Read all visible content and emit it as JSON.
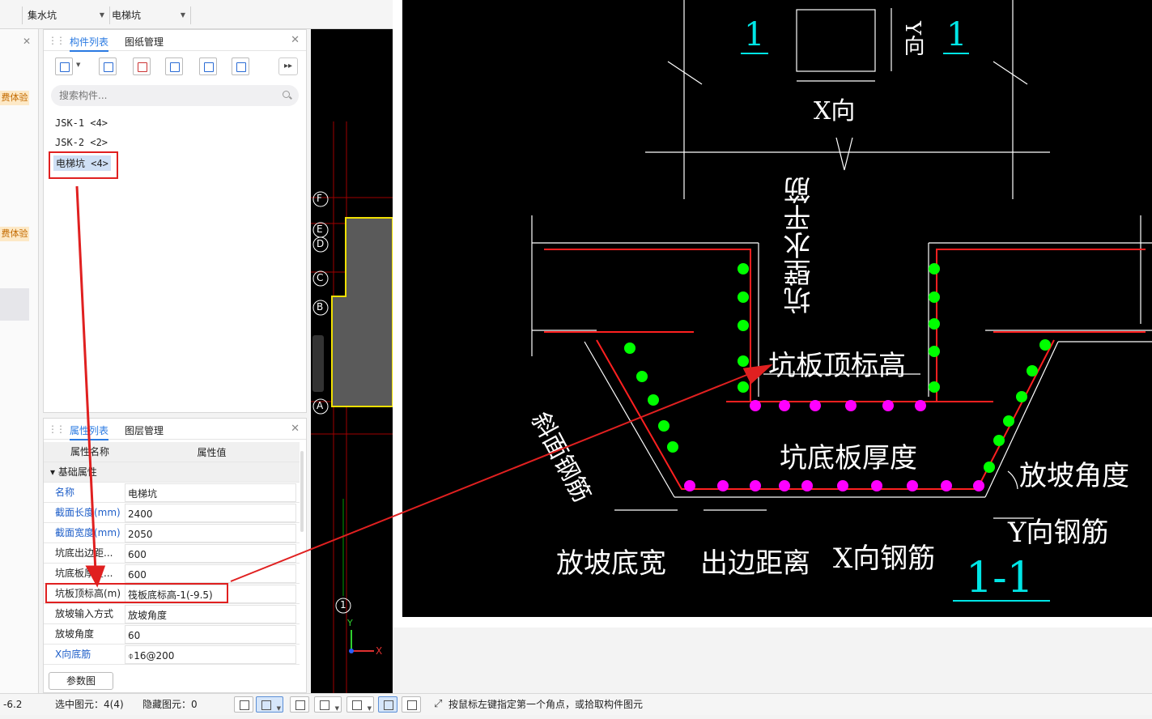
{
  "toolbar": {
    "left_value": "",
    "type_select": "集水坑",
    "component_select": "电梯坑"
  },
  "left_strip": {
    "badge_1": "费体验",
    "badge_2": "费体验"
  },
  "component_panel": {
    "tabs": [
      {
        "label": "构件列表",
        "active": true
      },
      {
        "label": "图纸管理",
        "active": false
      }
    ],
    "more_label": "▸▸",
    "search_placeholder": "搜索构件...",
    "items": [
      {
        "label": "JSK-1 <4>"
      },
      {
        "label": "JSK-2 <2>"
      },
      {
        "label": "电梯坑 <4>",
        "selected": true
      }
    ]
  },
  "properties_panel": {
    "tabs": [
      {
        "label": "属性列表",
        "active": true
      },
      {
        "label": "图层管理",
        "active": false
      }
    ],
    "header": {
      "name": "属性名称",
      "value": "属性值"
    },
    "group": "基础属性",
    "rows": [
      {
        "name": "名称",
        "value": "电梯坑",
        "blue": true
      },
      {
        "name": "截面长度(mm)",
        "value": "2400",
        "blue": true
      },
      {
        "name": "截面宽度(mm)",
        "value": "2050",
        "blue": true
      },
      {
        "name": "坑底出边距...",
        "value": "600",
        "blue": false
      },
      {
        "name": "坑底板厚度...",
        "value": "600",
        "blue": false
      },
      {
        "name": "坑板顶标高(m)",
        "value": "筏板底标高-1(-9.5)",
        "blue": false
      },
      {
        "name": "放坡输入方式",
        "value": "放坡角度",
        "blue": false
      },
      {
        "name": "放坡角度",
        "value": "60",
        "blue": false
      },
      {
        "name": "X向底筋",
        "value": "⌽16@200",
        "blue": true
      }
    ],
    "param_button": "参数图"
  },
  "canvas": {
    "axis_labels": [
      "F",
      "E",
      "D",
      "C",
      "B",
      "A"
    ],
    "axis_number": "1",
    "x_label": "X",
    "y_label": "Y"
  },
  "detail_drawing": {
    "plan_mark_left": "1",
    "plan_mark_right": "1",
    "y_dir": "Y向",
    "x_dir": "X向",
    "labels": {
      "wall_horizontal_rebar": "坑壁水平筋",
      "slab_top_elevation": "坑板顶标高",
      "slope_rebar": "斜面钢筋",
      "bottom_slab_thickness": "坑底板厚度",
      "slope_angle": "放坡角度",
      "y_rebar": "Y向钢筋",
      "slope_bottom_width": "放坡底宽",
      "edge_distance": "出边距离",
      "x_rebar": "X向钢筋",
      "section_title": "1-1"
    }
  },
  "statusbar": {
    "coord": "-6.2",
    "selected": "选中图元：4(4)",
    "hidden": "隐藏图元：0",
    "hint": "按鼠标左键指定第一个角点，或拾取构件图元"
  },
  "colors": {
    "accent": "#2a7ae2",
    "highlight": "#e02020",
    "rebar_green": "#00ff00",
    "rebar_magenta": "#ff00ff",
    "section_cyan": "#00e5e5"
  }
}
